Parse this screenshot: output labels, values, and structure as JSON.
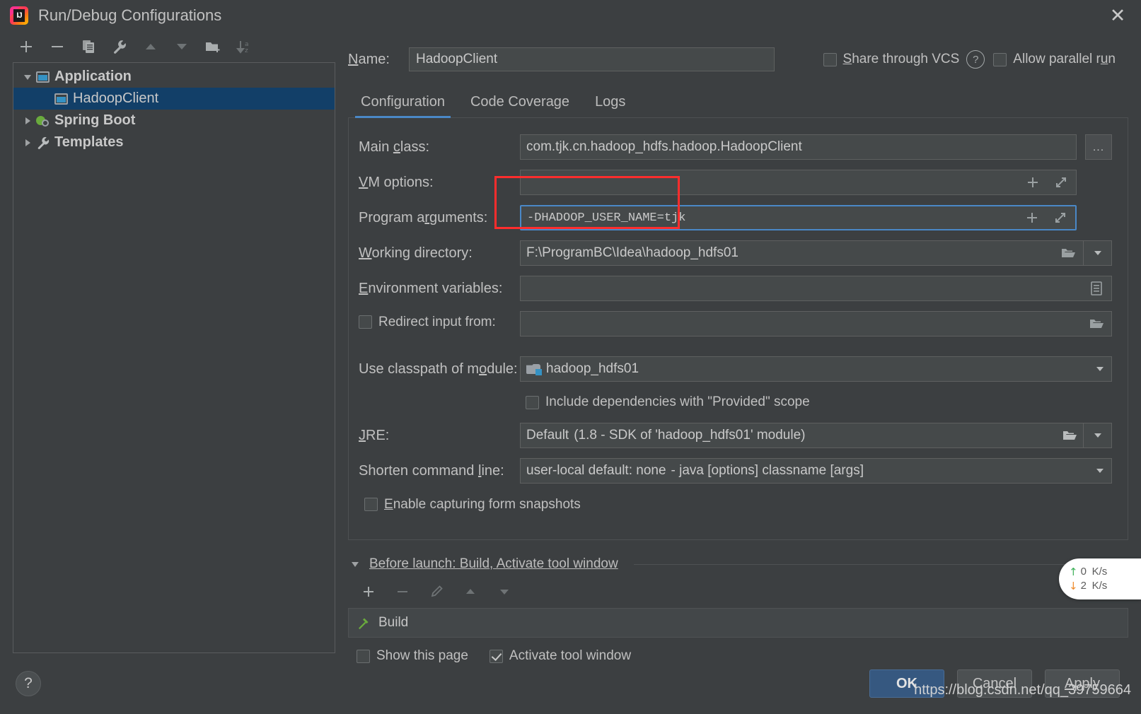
{
  "window": {
    "title": "Run/Debug Configurations",
    "logo_icon": "intellij-idea-logo",
    "close_icon": "close-icon"
  },
  "tree_toolbar": [
    {
      "name": "add-configuration-button",
      "icon": "plus-icon"
    },
    {
      "name": "remove-configuration-button",
      "icon": "minus-icon"
    },
    {
      "name": "copy-configuration-button",
      "icon": "copy-icon"
    },
    {
      "name": "edit-templates-button",
      "icon": "wrench-icon"
    },
    {
      "name": "move-up-button",
      "icon": "triangle-up-icon"
    },
    {
      "name": "move-down-button",
      "icon": "triangle-down-icon"
    },
    {
      "name": "new-folder-button",
      "icon": "folder-add-icon"
    },
    {
      "name": "sort-configurations-button",
      "icon": "sort-alpha-icon"
    }
  ],
  "tree": {
    "items": [
      {
        "label": "Application",
        "icon": "application-icon",
        "expanded": true,
        "level": 0,
        "selected": false,
        "has_arrow": true
      },
      {
        "label": "HadoopClient",
        "icon": "application-icon",
        "expanded": false,
        "level": 1,
        "selected": true,
        "has_arrow": false
      },
      {
        "label": "Spring Boot",
        "icon": "spring-boot-icon",
        "expanded": false,
        "level": 0,
        "selected": false,
        "has_arrow": true
      },
      {
        "label": "Templates",
        "icon": "wrench-icon",
        "expanded": false,
        "level": 0,
        "selected": false,
        "has_arrow": true
      }
    ]
  },
  "name_row": {
    "label": "Name:",
    "label_mnemonic": "N",
    "value": "HadoopClient",
    "share_vcs": {
      "label_prefix": "S",
      "label": "hare through VCS",
      "checked": false
    },
    "help_icon": "question-mark-icon",
    "allow_parallel": {
      "label": "Allow parallel run",
      "checked": false
    }
  },
  "tabs": [
    {
      "label": "Configuration",
      "active": true
    },
    {
      "label": "Code Coverage",
      "active": false
    },
    {
      "label": "Logs",
      "active": false
    }
  ],
  "form": {
    "main_class": {
      "label": "Main class:",
      "value": "com.tjk.cn.hadoop_hdfs.hadoop.HadoopClient",
      "browse_label": "...",
      "browse_icon": "ellipsis-icon"
    },
    "vm_options": {
      "label": "VM options:",
      "value": "",
      "macro_icon": "plus-icon",
      "expand_icon": "expand-diagonal-icon"
    },
    "program_arguments": {
      "label": "Program arguments:",
      "value": "-DHADOOP_USER_NAME=tjk",
      "focused": true,
      "macro_icon": "plus-icon",
      "expand_icon": "expand-diagonal-icon"
    },
    "working_directory": {
      "label": "Working directory:",
      "value": "F:\\ProgramBC\\Idea\\hadoop_hdfs01",
      "browse_icon": "folder-open-icon",
      "dropdown_icon": "chevron-down-icon"
    },
    "environment_variables": {
      "label": "Environment variables:",
      "value": "",
      "browse_icon": "env-list-icon"
    },
    "redirect_input": {
      "label": "Redirect input from:",
      "checked": false,
      "value": "",
      "browse_icon": "folder-open-icon"
    },
    "use_classpath": {
      "label": "Use classpath of module:",
      "value": "hadoop_hdfs01",
      "module_icon": "module-icon",
      "dropdown_icon": "chevron-down-icon"
    },
    "include_provided": {
      "label": "Include dependencies with \"Provided\" scope",
      "checked": false
    },
    "jre": {
      "label": "JRE:",
      "value": "Default",
      "value_hint": "(1.8 - SDK of 'hadoop_hdfs01' module)",
      "browse_icon": "folder-open-icon",
      "dropdown_icon": "chevron-down-icon"
    },
    "shorten_command_line": {
      "label": "Shorten command line:",
      "value": "user-local default: none",
      "value_hint": "- java [options] classname [args]",
      "dropdown_icon": "chevron-down-icon"
    },
    "enable_snapshots": {
      "label": "Enable capturing form snapshots",
      "checked": false
    }
  },
  "before_launch": {
    "title": "Before launch: Build, Activate tool window",
    "collapse_icon": "triangle-down-icon",
    "toolbar": [
      {
        "name": "add-task-button",
        "icon": "plus-icon",
        "enabled": true
      },
      {
        "name": "remove-task-button",
        "icon": "minus-icon",
        "enabled": false
      },
      {
        "name": "edit-task-button",
        "icon": "pencil-icon",
        "enabled": false
      },
      {
        "name": "move-task-up-button",
        "icon": "triangle-up-icon",
        "enabled": false
      },
      {
        "name": "move-task-down-button",
        "icon": "triangle-down-icon",
        "enabled": false
      }
    ],
    "tasks": [
      {
        "label": "Build",
        "icon": "hammer-icon"
      }
    ],
    "show_this_page": {
      "label": "Show this page",
      "checked": false
    },
    "activate_tool_window": {
      "label": "Activate tool window",
      "checked": true
    }
  },
  "bottom": {
    "help_icon": "question-mark-icon",
    "ok_label": "OK",
    "cancel_label": "Cancel",
    "apply_label": "Apply"
  },
  "net_widget": {
    "up_arrow": "arrow-up-icon",
    "up_value": "0",
    "up_unit": "K/s",
    "down_arrow": "arrow-down-icon",
    "down_value": "2",
    "down_unit": "K/s"
  },
  "watermark": {
    "text": "https://blog.csdn.net/qq_39759664"
  },
  "colors": {
    "background": "#3c3f41",
    "field": "#45494a",
    "selection": "#123f68",
    "accent": "#4a88c7",
    "primary_button": "#365880",
    "annotation": "#ff2d2d",
    "build_icon": "#6aab3d"
  }
}
